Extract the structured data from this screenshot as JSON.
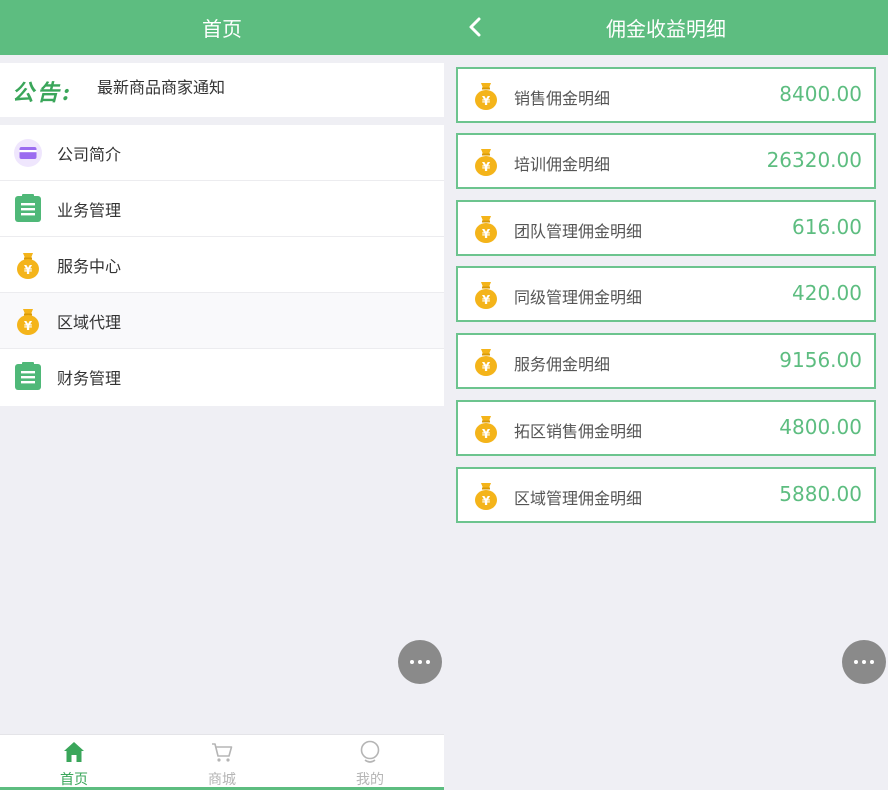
{
  "colors": {
    "brand": "#5dbd80",
    "icon_gold": "#f4b41a",
    "icon_purple": "#9b6cf0",
    "fab": "#8a8a8a"
  },
  "home": {
    "title": "首页",
    "notice": {
      "tag": "公告:",
      "text": "最新商品商家通知"
    },
    "menu": [
      {
        "label": "公司简介",
        "icon": "card-icon"
      },
      {
        "label": "业务管理",
        "icon": "clipboard-icon"
      },
      {
        "label": "服务中心",
        "icon": "money-bag-icon"
      },
      {
        "label": "区域代理",
        "icon": "money-bag-icon"
      },
      {
        "label": "财务管理",
        "icon": "clipboard-icon"
      }
    ],
    "tabs": [
      {
        "label": "首页",
        "icon": "home-icon",
        "active": true
      },
      {
        "label": "商城",
        "icon": "cart-icon",
        "active": false
      },
      {
        "label": "我的",
        "icon": "user-icon",
        "active": false
      }
    ]
  },
  "commission": {
    "title": "佣金收益明细",
    "items": [
      {
        "label": "销售佣金明细",
        "amount": "8400.00"
      },
      {
        "label": "培训佣金明细",
        "amount": "26320.00"
      },
      {
        "label": "团队管理佣金明细",
        "amount": "616.00"
      },
      {
        "label": "同级管理佣金明细",
        "amount": "420.00"
      },
      {
        "label": "服务佣金明细",
        "amount": "9156.00"
      },
      {
        "label": "拓区销售佣金明细",
        "amount": "4800.00"
      },
      {
        "label": "区域管理佣金明细",
        "amount": "5880.00"
      }
    ]
  }
}
